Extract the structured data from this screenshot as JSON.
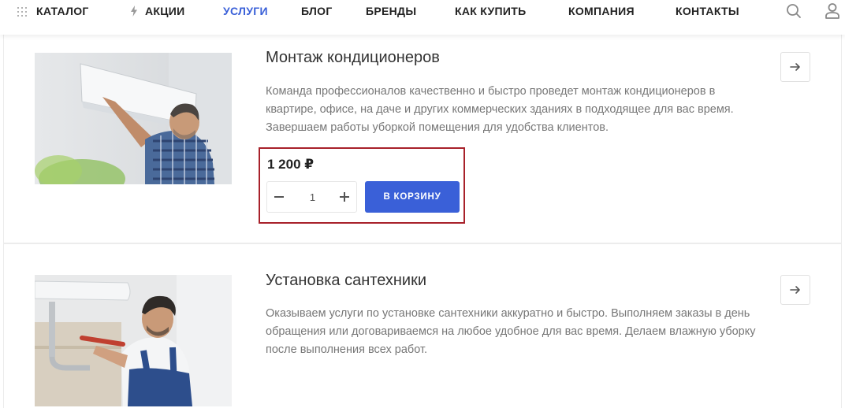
{
  "nav": {
    "catalog_label": "КАТАЛОГ",
    "sale_label": "АКЦИИ",
    "services_label": "УСЛУГИ",
    "blog_label": "БЛОГ",
    "brands_label": "БРЕНДЫ",
    "how_to_buy_label": "КАК КУПИТЬ",
    "company_label": "КОМПАНИЯ",
    "contacts_label": "КОНТАКТЫ",
    "active_item": "УСЛУГИ",
    "icons": [
      "grid-icon",
      "bolt-icon",
      "search-icon",
      "user-icon"
    ]
  },
  "colors": {
    "accent": "#3a60d8",
    "highlight_border": "#a8212a",
    "text_muted": "#777777"
  },
  "services": [
    {
      "title": "Монтаж кондиционеров",
      "description": "Команда профессионалов качественно и быстро проведет монтаж кондиционеров в квартире, офисе, на даче и других коммерческих зданиях в подходящее для вас время. Завершаем работы уборкой помещения для удобства клиентов.",
      "price": "1 200 ₽",
      "quantity": "1",
      "cart_button_label": "В КОРЗИНУ",
      "image": "air-conditioner-installer-photo"
    },
    {
      "title": "Установка сантехники",
      "description": "Оказываем услуги по установке сантехники аккуратно и быстро. Выполняем заказы в день обращения или договариваемся на любое удобное для вас время. Делаем влажную уборку после выполнения всех работ.",
      "image": "plumber-photo"
    }
  ]
}
